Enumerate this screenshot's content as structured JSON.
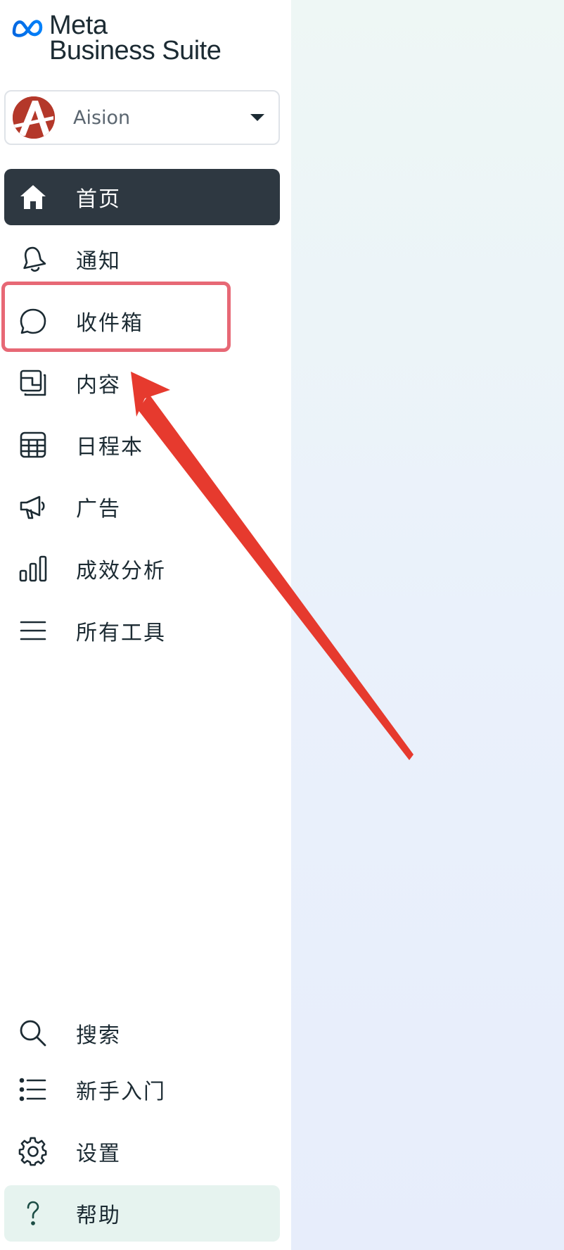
{
  "brand": {
    "line1": "Meta",
    "line2": "Business Suite",
    "logo_icon": "meta-infinity-logo"
  },
  "account": {
    "name": "Aision",
    "avatar_letter": "A",
    "dropdown_icon": "caret-down-icon"
  },
  "nav": {
    "home": "首页",
    "notifications": "通知",
    "inbox": "收件箱",
    "content": "内容",
    "planner": "日程本",
    "ads": "广告",
    "insights": "成效分析",
    "all_tools": "所有工具",
    "search": "搜索",
    "getting_started": "新手入门",
    "settings": "设置",
    "help": "帮助"
  },
  "colors": {
    "active_bg": "#2e3841",
    "highlight_border": "#e76875",
    "arrow": "#e63a2e",
    "help_bg": "#e6f3ef"
  }
}
